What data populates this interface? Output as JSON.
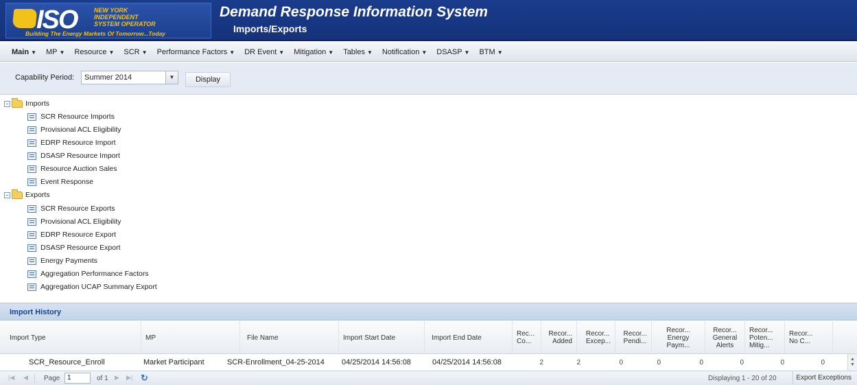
{
  "header": {
    "logo_text": "ISO",
    "logo_org": "NEW YORK\nINDEPENDENT\nSYSTEM OPERATOR",
    "logo_tagline": "Building The Energy Markets Of Tomorrow...Today",
    "title": "Demand Response Information System",
    "subtitle": "Imports/Exports"
  },
  "menu": [
    {
      "label": "Main"
    },
    {
      "label": "MP"
    },
    {
      "label": "Resource"
    },
    {
      "label": "SCR"
    },
    {
      "label": "Performance Factors"
    },
    {
      "label": "DR Event"
    },
    {
      "label": "Mitigation"
    },
    {
      "label": "Tables"
    },
    {
      "label": "Notification"
    },
    {
      "label": "DSASP"
    },
    {
      "label": "BTM"
    }
  ],
  "filter": {
    "label": "Capability Period:",
    "selected": "Summer 2014",
    "button": "Display"
  },
  "tree": {
    "imports_label": "Imports",
    "imports": [
      "SCR Resource Imports",
      "Provisional ACL Eligibility",
      "EDRP Resource Import",
      "DSASP Resource Import",
      "Resource Auction Sales",
      "Event Response"
    ],
    "exports_label": "Exports",
    "exports": [
      "SCR Resource Exports",
      "Provisional ACL Eligibility",
      "EDRP Resource Export",
      "DSASP Resource Export",
      "Energy Payments",
      "Aggregation Performance Factors",
      "Aggregation UCAP Summary Export"
    ]
  },
  "history": {
    "title": "Import History",
    "columns": [
      "Import Type",
      "MP",
      "File Name",
      "Import Start Date",
      "Import End Date",
      "Rec...\nCo...",
      "Recor...\nAdded",
      "Recor...\nExcep...",
      "Recor...\nPendi...",
      "Recor...\nEnergy\nPaym...",
      "Recor...\nGeneral\nAlerts",
      "Recor...\nPoten...\nMitig...",
      "Recor...\nNo C..."
    ],
    "rows": [
      {
        "import_type": "SCR_Resource_Enroll",
        "mp": "Market Participant",
        "file_name": "SCR-Enrollment_04-25-2014",
        "start": "04/25/2014 14:56:08",
        "end": "04/25/2014 14:56:08",
        "rec_count": "2",
        "added": "2",
        "exceptions": "0",
        "pending": "0",
        "energy_payments": "0",
        "general_alerts": "0",
        "potential_mitigation": "0",
        "no_change": "0"
      }
    ]
  },
  "pager": {
    "page_label": "Page",
    "page_value": "1",
    "of_label": "of 1",
    "displaying": "Displaying 1 - 20 of 20",
    "export_button": "Export Exceptions"
  }
}
